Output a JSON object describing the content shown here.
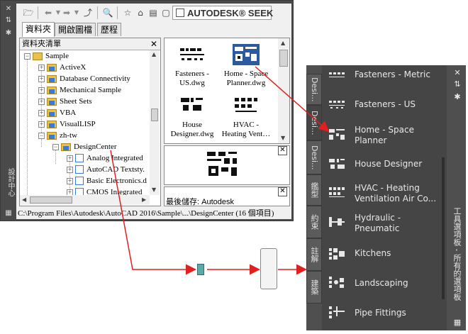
{
  "design_center": {
    "side_title": "設計中心",
    "seek_label": "AUTODESK® SEEK",
    "tabs": [
      "資料夾",
      "開啟圖檔",
      "歷程"
    ],
    "tree_title": "資料夾清單",
    "tree": [
      {
        "label": "Sample"
      },
      {
        "label": "ActiveX"
      },
      {
        "label": "Database Connectivity"
      },
      {
        "label": "Mechanical Sample"
      },
      {
        "label": "Sheet Sets"
      },
      {
        "label": "VBA"
      },
      {
        "label": "VisualLISP"
      },
      {
        "label": "zh-tw"
      },
      {
        "label": "DesignCenter"
      },
      {
        "label": "Analog Integrated"
      },
      {
        "label": "AutoCAD Textsty."
      },
      {
        "label": "Basic Electronics.d"
      },
      {
        "label": "CMOS Integrated"
      }
    ],
    "content_items": [
      {
        "label": "Fasteners - US.dwg"
      },
      {
        "label": "Home - Space Planner.dwg"
      },
      {
        "label": "House Designer.dwg"
      },
      {
        "label": "HVAC - Heating Vent…"
      }
    ],
    "description": "最後儲存: Autodesk",
    "status_path": "C:\\Program Files\\Autodesk\\AutoCAD 2016\\Sample\\...\\DesignCenter  (16 個項目)"
  },
  "tool_palettes": {
    "title": "工具選項板 - 所有的選項板",
    "tabs": [
      "Desi...",
      "Desi...",
      "Desi...",
      "鑑型",
      "約束",
      "註解",
      "建築"
    ],
    "items": [
      {
        "label": "Fasteners - Metric"
      },
      {
        "label": "Fasteners - US"
      },
      {
        "label": "Home - Space\nPlanner"
      },
      {
        "label": "House Designer"
      },
      {
        "label": "HVAC - Heating\nVentilation Air Co..."
      },
      {
        "label": "Hydraulic -\nPneumatic"
      },
      {
        "label": "Kitchens"
      },
      {
        "label": "Landscaping"
      },
      {
        "label": "Pipe Fittings"
      }
    ]
  },
  "colors": {
    "arrow": "#e02020",
    "panel_dark": "#454545",
    "selection": "#2c5aa0"
  }
}
